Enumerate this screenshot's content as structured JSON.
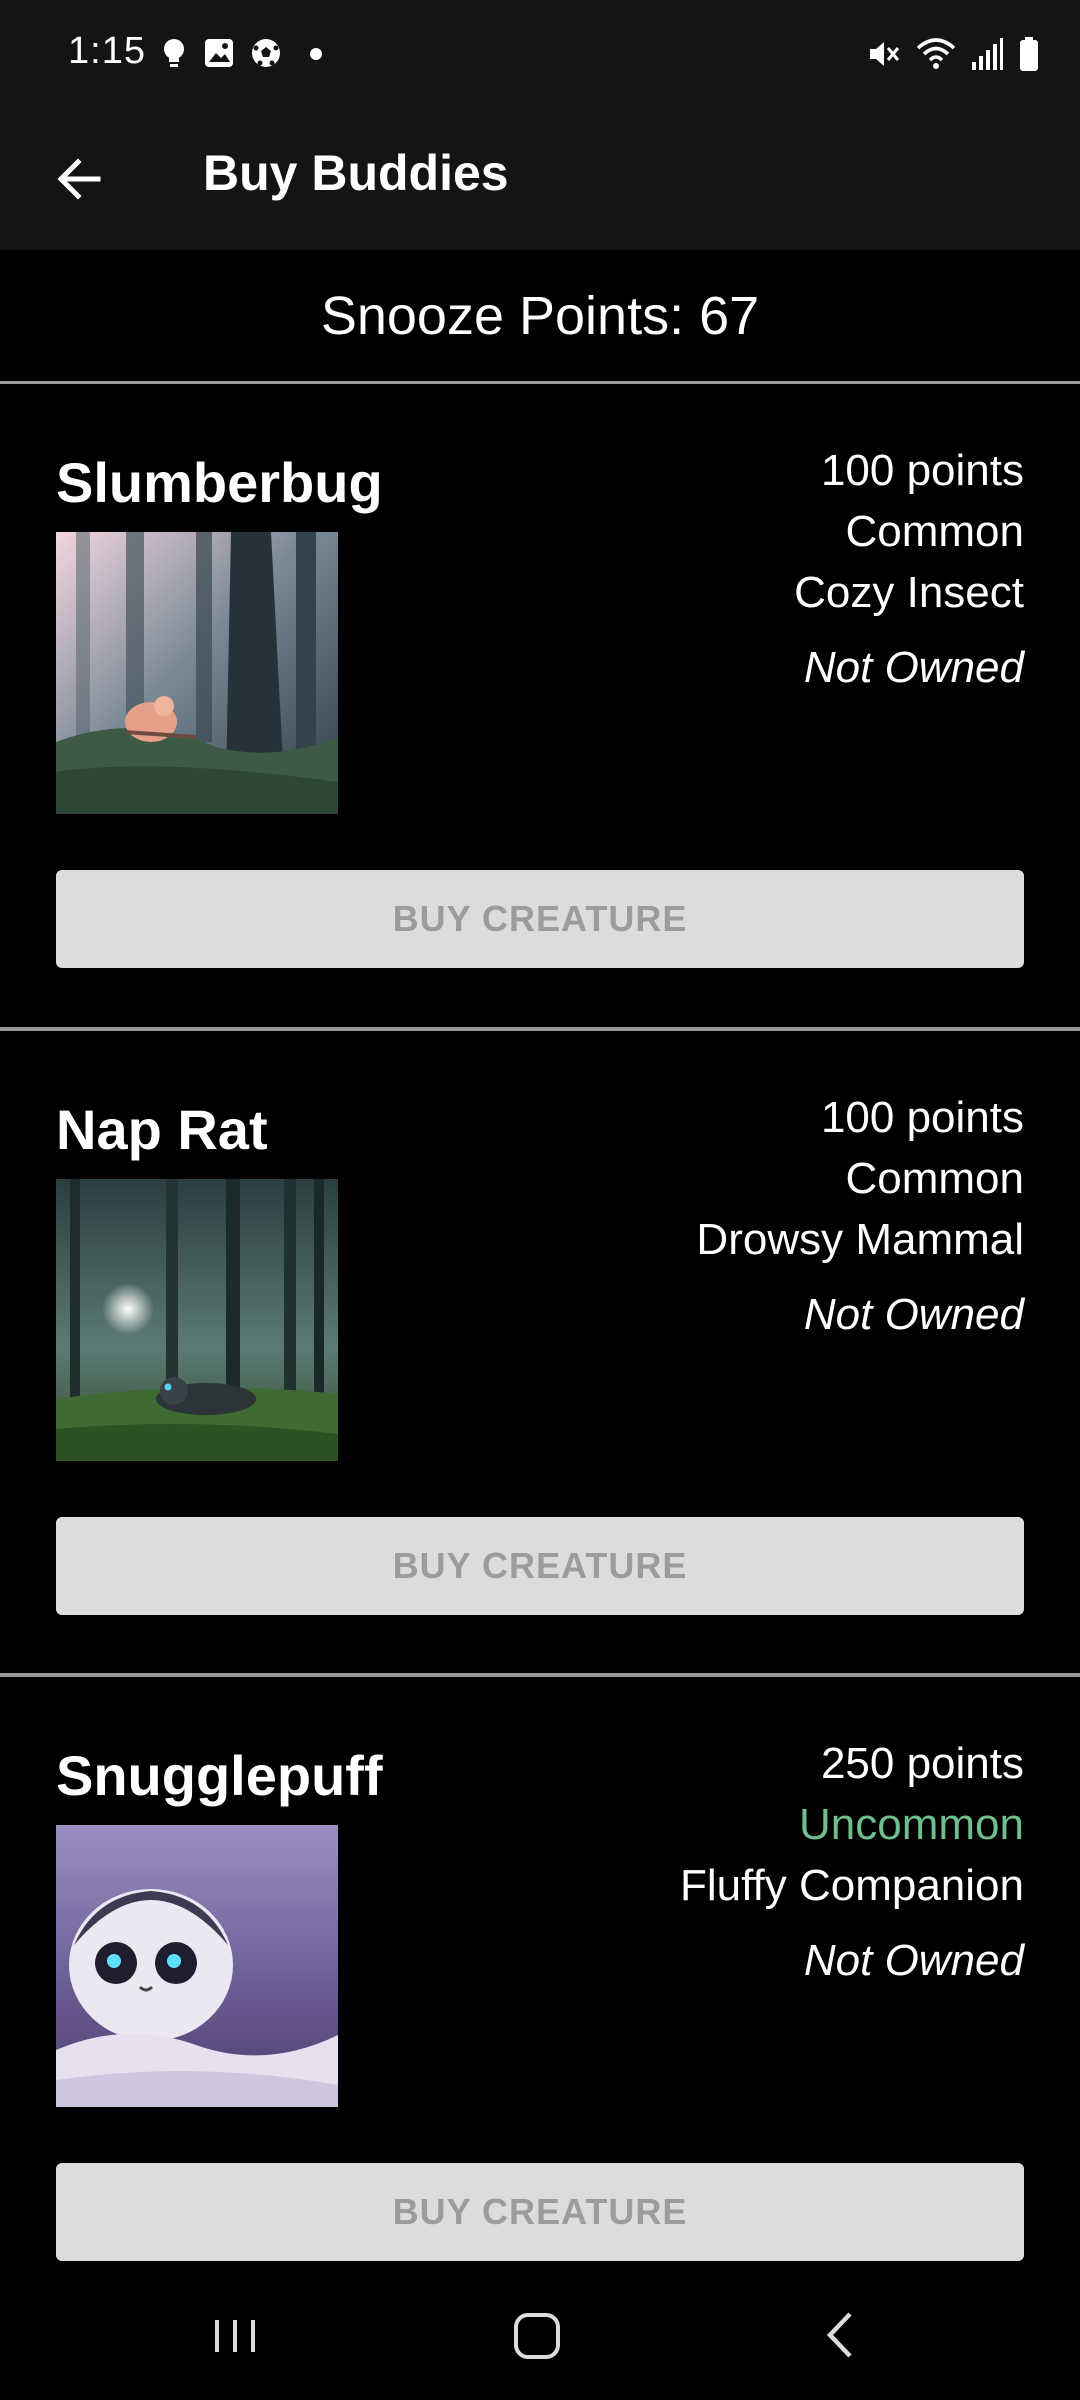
{
  "status_bar": {
    "time": "1:15",
    "left_icons": [
      "lightbulb-icon",
      "image-icon",
      "soccer-ball-icon",
      "dot-icon"
    ],
    "right_icons": [
      "mute-icon",
      "wifi-icon",
      "signal-icon",
      "battery-icon"
    ]
  },
  "app_bar": {
    "title": "Buy Buddies",
    "back_icon": "arrow-left-icon"
  },
  "points": {
    "label": "Snooze Points: 67"
  },
  "creatures": [
    {
      "name": "Slumberbug",
      "cost": "100 points",
      "rarity": "Common",
      "rarity_color": "#ffffff",
      "category": "Cozy Insect",
      "ownership": "Not Owned",
      "button_label": "BUY CREATURE"
    },
    {
      "name": "Nap Rat",
      "cost": "100 points",
      "rarity": "Common",
      "rarity_color": "#ffffff",
      "category": "Drowsy Mammal",
      "ownership": "Not Owned",
      "button_label": "BUY CREATURE"
    },
    {
      "name": "Snugglepuff",
      "cost": "250 points",
      "rarity": "Uncommon",
      "rarity_color": "#6fbf8e",
      "category": "Fluffy Companion",
      "ownership": "Not Owned",
      "button_label": "BUY CREATURE"
    }
  ],
  "nav_bar": {
    "icons": [
      "recents-icon",
      "home-icon",
      "back-icon"
    ]
  },
  "colors": {
    "background": "#000000",
    "bar_background": "#141414",
    "divider": "#9a9a9a",
    "button_bg": "#dcdcdc",
    "button_text": "#9c9c9c",
    "uncommon": "#6fbf8e"
  }
}
